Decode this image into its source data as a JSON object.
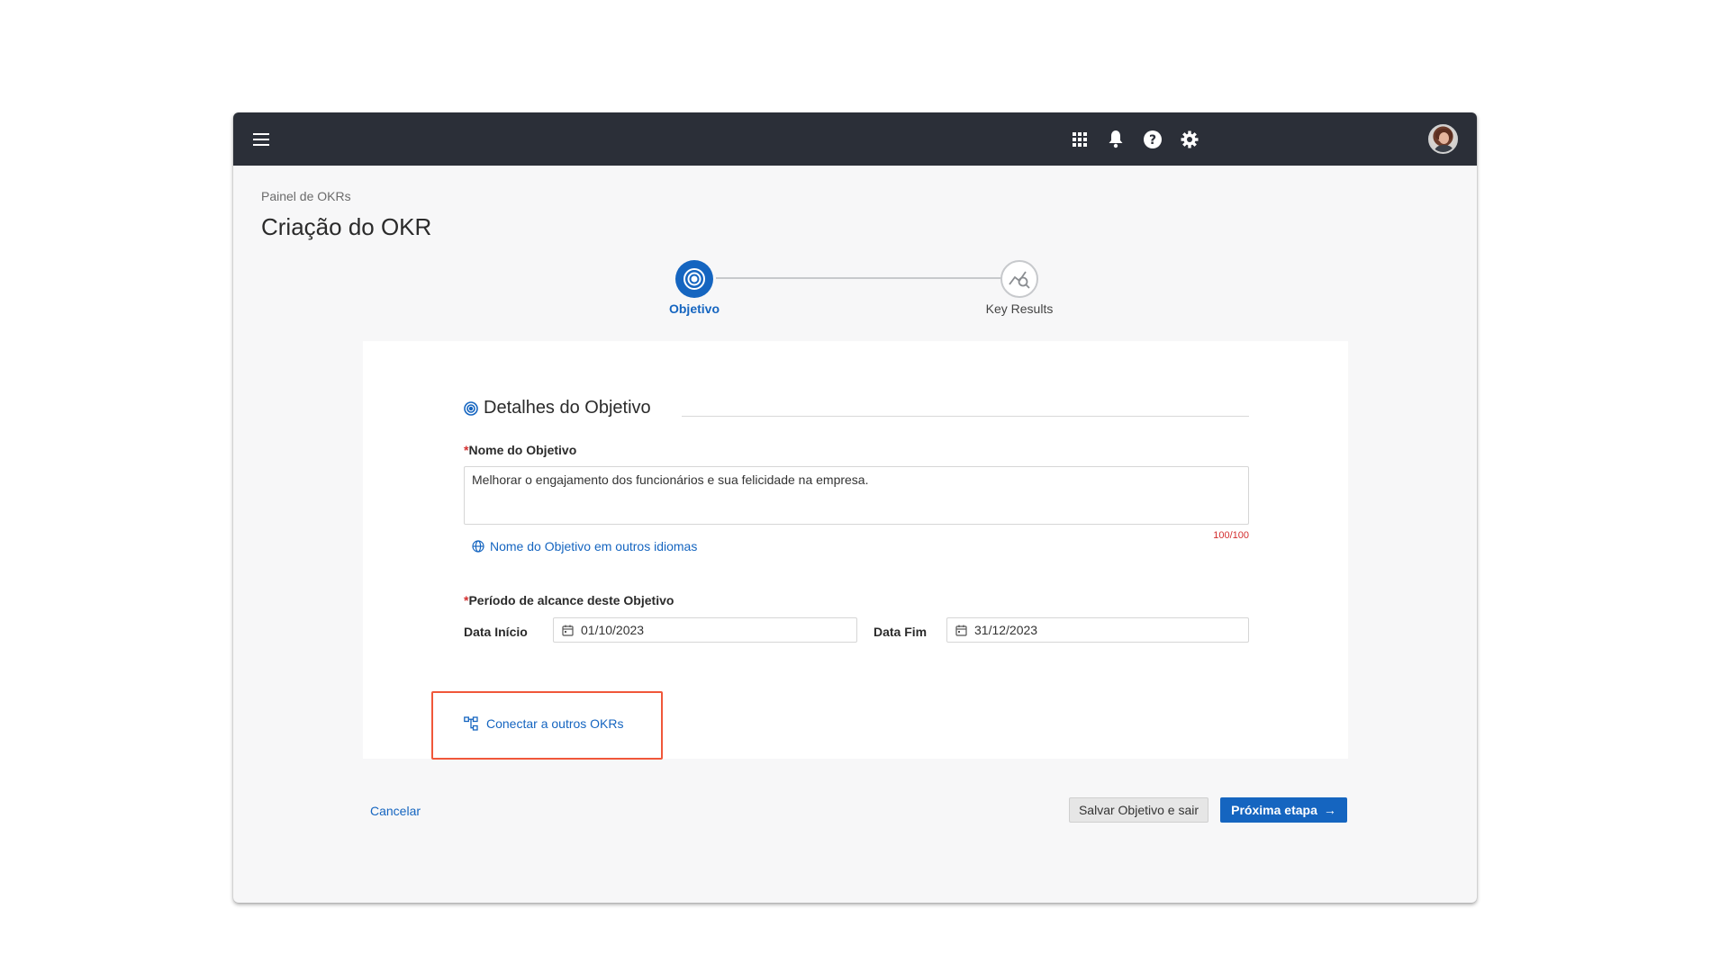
{
  "topbar": {
    "icons": [
      "menu-icon",
      "apps-grid-icon",
      "bell-icon",
      "help-icon",
      "gear-icon"
    ]
  },
  "breadcrumb": "Painel de OKRs",
  "page_title": "Criação do OKR",
  "stepper": {
    "steps": [
      {
        "label": "Objetivo",
        "state": "active"
      },
      {
        "label": "Key Results",
        "state": "pending"
      }
    ]
  },
  "objective": {
    "section_title": "Detalhes do Objetivo",
    "name_label": "Nome do Objetivo",
    "required_mark": "*",
    "name_value": "Melhorar o engajamento dos funcionários e sua felicidade na empresa.",
    "counter": "100/100",
    "other_languages_link": "Nome do Objetivo em outros idiomas",
    "period_label": "Período de alcance deste Objetivo",
    "start_label": "Data Início",
    "start_value": "01/10/2023",
    "end_label": "Data Fim",
    "end_value": "31/12/2023",
    "connect_link": "Conectar a outros OKRs"
  },
  "footer": {
    "cancel_label": "Cancelar",
    "save_label": "Salvar Objetivo e sair",
    "next_label": "Próxima etapa",
    "next_arrow": "→"
  },
  "colors": {
    "primary": "#1565c0",
    "topbar": "#2b2f38",
    "required": "#d32f2f",
    "highlight": "#f0573a"
  }
}
